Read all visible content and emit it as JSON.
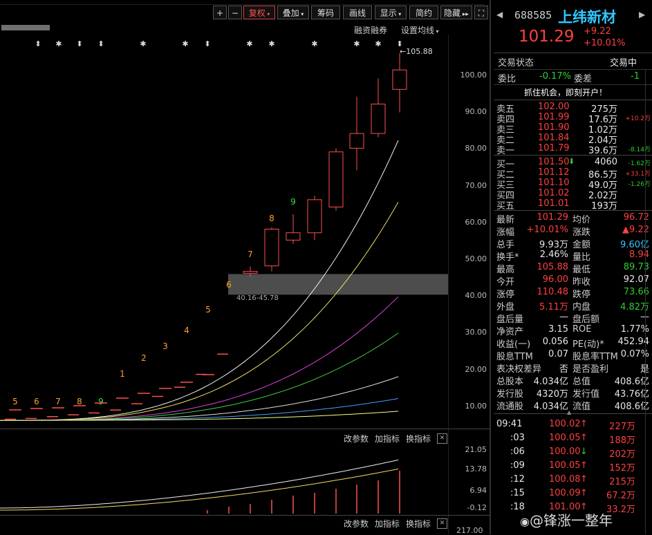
{
  "toolbar": {
    "plus": "+",
    "minus": "−",
    "fuquan": "复权",
    "diejia": "叠加",
    "chouma": "筹码",
    "huaxian": "画线",
    "xianshi": "显示",
    "jianyue": "简约",
    "yincang": "隐藏",
    "fullscreen": "⛶"
  },
  "chart_header": {
    "rzrq": "融资融券",
    "ma_setting": "设置均线"
  },
  "stock": {
    "code": "688585",
    "name": "上纬新材",
    "price": "101.29",
    "change": "+9.22",
    "change_pct": "+10.01%"
  },
  "status": {
    "label": "交易状态",
    "value": "交易中"
  },
  "weibi": {
    "label": "委比",
    "value": "-0.17%",
    "label2": "委差",
    "value2": "-1"
  },
  "promo": "抓住机会，即刻开户！",
  "sells": [
    {
      "label": "卖五",
      "price": "102.00",
      "vol": "275万",
      "chg": ""
    },
    {
      "label": "卖四",
      "price": "101.99",
      "vol": "17.6万",
      "chg": "+10.2万"
    },
    {
      "label": "卖三",
      "price": "101.90",
      "vol": "1.02万",
      "chg": ""
    },
    {
      "label": "卖二",
      "price": "101.84",
      "vol": "2.04万",
      "chg": ""
    },
    {
      "label": "卖一",
      "price": "101.79",
      "vol": "39.6万",
      "chg": "-8.14万"
    }
  ],
  "buys": [
    {
      "label": "买一",
      "price": "101.50",
      "vol": "4060",
      "chg": "-1.62万"
    },
    {
      "label": "买二",
      "price": "101.12",
      "vol": "86.5万",
      "chg": "+33.1万"
    },
    {
      "label": "买三",
      "price": "101.10",
      "vol": "49.0万",
      "chg": "-1.26万"
    },
    {
      "label": "买四",
      "price": "101.02",
      "vol": "2.02万",
      "chg": ""
    },
    {
      "label": "买五",
      "price": "101.01",
      "vol": "193万",
      "chg": ""
    }
  ],
  "stats": [
    {
      "l1": "最新",
      "v1": "101.29",
      "l2": "均价",
      "v2": "96.72"
    },
    {
      "l1": "涨幅",
      "v1": "+10.01%",
      "l2": "涨跌",
      "v2": "▲9.22"
    },
    {
      "l1": "总手",
      "v1": "9.93万",
      "l2": "金额",
      "v2": "9.60亿"
    },
    {
      "l1": "换手*",
      "v1": "2.46%",
      "l2": "量比",
      "v2": "8.94"
    },
    {
      "l1": "最高",
      "v1": "105.88",
      "l2": "最低",
      "v2": "89.73"
    },
    {
      "l1": "今开",
      "v1": "96.00",
      "l2": "昨收",
      "v2": "92.07"
    },
    {
      "l1": "涨停",
      "v1": "110.48",
      "l2": "跌停",
      "v2": "73.66"
    },
    {
      "l1": "外盘",
      "v1": "5.11万",
      "l2": "内盘",
      "v2": "4.82万"
    },
    {
      "l1": "盘后量",
      "v1": "—",
      "l2": "盘后额",
      "v2": "—"
    },
    {
      "l1": "净资产",
      "v1": "3.15",
      "l2": "ROE",
      "v2": "1.77%"
    },
    {
      "l1": "收益(一)",
      "v1": "0.056",
      "l2": "PE(动)*",
      "v2": "452.94"
    },
    {
      "l1": "股息TTM",
      "v1": "0.07",
      "l2": "股息率TTM",
      "v2": "0.07%"
    },
    {
      "l1": "表决权差异",
      "v1": "否",
      "l2": "是否盈利",
      "v2": "是"
    },
    {
      "l1": "总股本",
      "v1": "4.034亿",
      "l2": "总值",
      "v2": "408.6亿"
    },
    {
      "l1": "发行股",
      "v1": "4320万",
      "l2": "发行值",
      "v2": "43.76亿"
    },
    {
      "l1": "流通股",
      "v1": "4.034亿",
      "l2": "流值",
      "v2": "408.6亿"
    }
  ],
  "ticks": [
    {
      "time": "09:41",
      "price": "100.02",
      "dir": "↑",
      "vol": "227万"
    },
    {
      "time": ":03",
      "price": "100.05",
      "dir": "↑",
      "vol": "188万"
    },
    {
      "time": ":06",
      "price": "100.00",
      "dir": "↓",
      "vol": "202万"
    },
    {
      "time": ":09",
      "price": "100.05",
      "dir": "↑",
      "vol": "152万"
    },
    {
      "time": ":12",
      "price": "100.08",
      "dir": "↑",
      "vol": "215万"
    },
    {
      "time": ":15",
      "price": "100.09",
      "dir": "↑",
      "vol": "67.2万"
    },
    {
      "time": ":18",
      "price": "101.00",
      "dir": "↑",
      "vol": "33.2万"
    }
  ],
  "price_axis": [
    "100.00",
    "90.00",
    "80.00",
    "70.00",
    "60.00",
    "50.00",
    "40.00",
    "30.00",
    "20.00",
    "10.00"
  ],
  "max_label": "105.88",
  "gap_label": "40.16-45.78",
  "ind_toolbar": {
    "params": "改参数",
    "add": "加指标",
    "switch": "换指标",
    "close": "✕"
  },
  "ind_axis": [
    "21.05",
    "13.78",
    "6.94",
    "-0.12"
  ],
  "ind2_axis": "217.00",
  "seq_numbers": [
    "5",
    "6",
    "7",
    "8",
    "9",
    "1",
    "2",
    "3",
    "4",
    "5",
    "6",
    "7",
    "8",
    "9"
  ],
  "watermark": "@锋涨一整年",
  "chart_data": {
    "type": "candlestick",
    "y_range": [
      0,
      110
    ],
    "candles": [
      {
        "open": 46.0,
        "close": 46.5,
        "high": 47.8,
        "low": 45.0
      },
      {
        "open": 48.0,
        "close": 58.0,
        "high": 58.5,
        "low": 46.5
      },
      {
        "open": 55.0,
        "close": 57.0,
        "high": 62.0,
        "low": 54.0
      },
      {
        "open": 57.0,
        "close": 66.0,
        "high": 67.0,
        "low": 55.0
      },
      {
        "open": 64.0,
        "close": 79.0,
        "high": 80.0,
        "low": 63.0
      },
      {
        "open": 80.0,
        "close": 84.0,
        "high": 94.0,
        "low": 74.0
      },
      {
        "open": 84.0,
        "close": 92.0,
        "high": 99.0,
        "low": 83.0
      },
      {
        "open": 96.0,
        "close": 101.29,
        "high": 105.88,
        "low": 89.73
      }
    ]
  }
}
